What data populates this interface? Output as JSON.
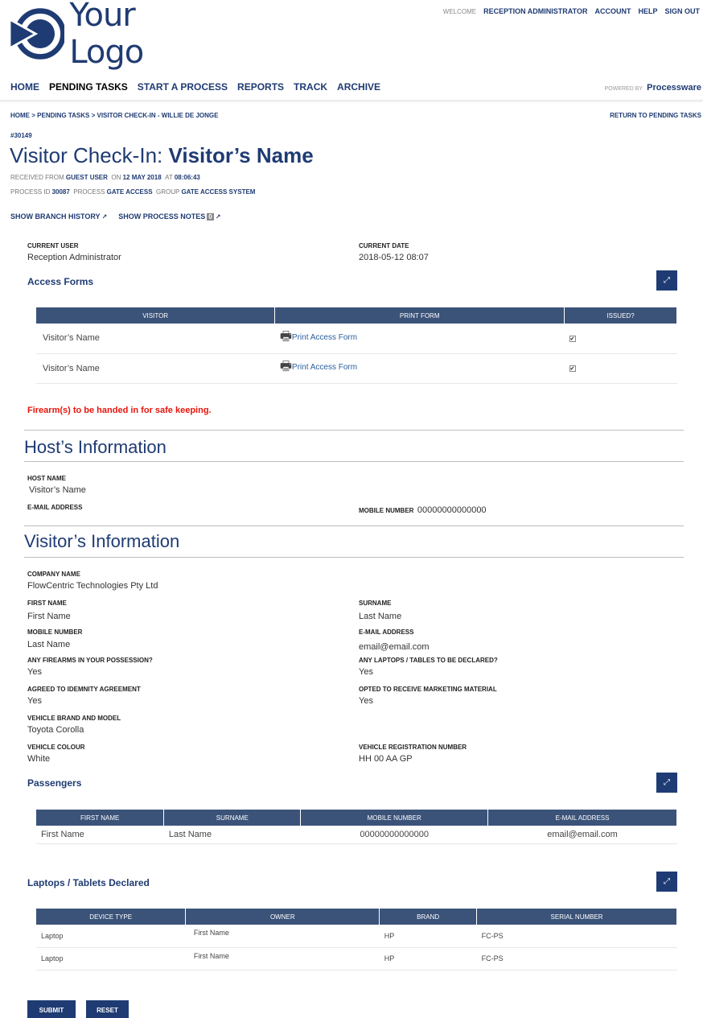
{
  "brand": {
    "logo_text": "Your Logo",
    "color": "#1f3b73"
  },
  "topbar": {
    "welcome": "WELCOME",
    "user": "RECEPTION ADMINISTRATOR",
    "links": [
      "ACCOUNT",
      "HELP",
      "SIGN OUT"
    ]
  },
  "nav": {
    "items": [
      "HOME",
      "PENDING TASKS",
      "START A PROCESS",
      "REPORTS",
      "TRACK",
      "ARCHIVE"
    ],
    "active": "PENDING TASKS"
  },
  "powered": {
    "label": "POWERED BY",
    "name": "Processware"
  },
  "breadcrumb": {
    "items": [
      "HOME",
      "PENDING TASKS",
      "VISITOR CHECK-IN - WILLIE DE JONGE"
    ],
    "return_label": "RETURN TO PENDING TASKS"
  },
  "task": {
    "ref": "#30149",
    "title_prefix": "Visitor Check-In:",
    "title_name": "Visitor’s Name",
    "received_from_label": "RECEIVED FROM",
    "received_from": "GUEST USER",
    "on_label": "ON",
    "date": "12 MAY 2018",
    "at_label": "AT",
    "time": "08:06:43",
    "process_id_label": "PROCESS ID",
    "process_id": "30087",
    "process_label": "PROCESS",
    "process": "GATE ACCESS",
    "group_label": "GROUP",
    "group": "GATE ACCESS SYSTEM"
  },
  "links": {
    "branch_history": "SHOW BRANCH HISTORY",
    "process_notes": "SHOW PROCESS NOTES",
    "notes_count": "0"
  },
  "current": {
    "user_label": "CURRENT USER",
    "user": "Reception Administrator",
    "date_label": "CURRENT DATE",
    "date": "2018-05-12 08:07"
  },
  "access_forms": {
    "title": "Access Forms",
    "headers": [
      "VISITOR",
      "PRINT FORM",
      "ISSUED?"
    ],
    "rows": [
      {
        "visitor": "Visitor’s Name",
        "link": "Print Access Form",
        "issued": true
      },
      {
        "visitor": "Visitor’s Name",
        "link": "Print Access Form",
        "issued": true
      }
    ]
  },
  "firearm_notice": "Firearm(s) to be handed in for safe keeping.",
  "host": {
    "title": "Host’s Information",
    "name_label": "HOST NAME",
    "name": "Visitor’s Name",
    "email_label": "E-MAIL ADDRESS",
    "email": "",
    "mobile_label": "MOBILE NUMBER",
    "mobile": "00000000000000"
  },
  "visitor": {
    "title": "Visitor’s Information",
    "company_label": "COMPANY NAME",
    "company": "FlowCentric Technologies Pty Ltd",
    "first_name_label": "FIRST NAME",
    "first_name": "First Name",
    "surname_label": "SURNAME",
    "surname": "Last Name",
    "mobile_label": "MOBILE NUMBER",
    "mobile": "Last Name",
    "email_label": "E-MAIL ADDRESS",
    "email": "email@email.com",
    "firearms_label": "ANY FIREARMS IN YOUR POSSESSION?",
    "firearms": "Yes",
    "laptops_label": "ANY LAPTOPS / TABLES TO BE DECLARED?",
    "laptops": "Yes",
    "indemnity_label": "AGREED TO IDEMNITY AGREEMENT",
    "indemnity": "Yes",
    "marketing_label": "OPTED TO RECEIVE MARKETING MATERIAL",
    "marketing": "Yes",
    "vehicle_label": "VEHICLE BRAND AND MODEL",
    "vehicle": "Toyota Corolla",
    "colour_label": "VEHICLE COLOUR",
    "colour": "White",
    "registration_label": "VEHICLE REGISTRATION NUMBER",
    "registration": "HH 00 AA GP"
  },
  "passengers": {
    "title": "Passengers",
    "headers": [
      "FIRST NAME",
      "SURNAME",
      "MOBILE NUMBER",
      "E-MAIL ADDRESS"
    ],
    "rows": [
      [
        "First Name",
        "Last Name",
        "00000000000000",
        "email@email.com"
      ]
    ]
  },
  "laptops": {
    "title": "Laptops / Tablets Declared",
    "headers": [
      "DEVICE TYPE",
      "OWNER",
      "BRAND",
      "SERIAL NUMBER"
    ],
    "rows": [
      [
        "Laptop",
        "First Name",
        "HP",
        "FC-PS"
      ],
      [
        "Laptop",
        "First Name",
        "HP",
        "FC-PS"
      ]
    ]
  },
  "buttons": {
    "submit": "SUBMIT",
    "reset": "RESET"
  },
  "icons": {
    "logo": "play-circle-icon",
    "external": "external-link-icon",
    "expand": "expand-icon",
    "printer": "printer-icon",
    "checkbox": "checkbox-icon"
  }
}
